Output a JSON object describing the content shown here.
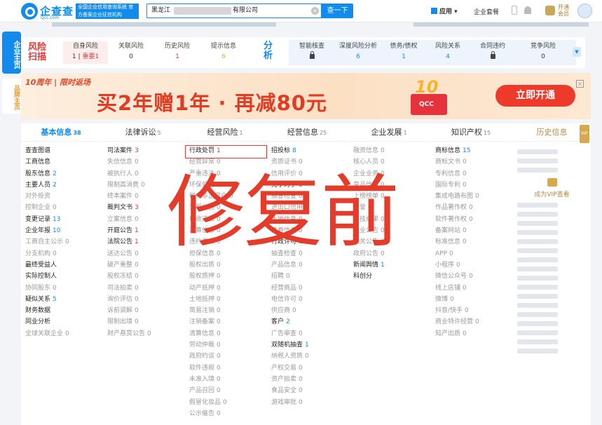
{
  "header": {
    "logo_name": "企查查",
    "logo_sub": "Qcc.com",
    "slogan": "全国企业信用查询系统 官方备案企业征信机构",
    "search_prefix": "黑龙江",
    "search_suffix": "有限公司",
    "search_button": "查一下",
    "apps_label": "应用",
    "enterprise_pack": "企业套餐",
    "vip_label": "开通会员"
  },
  "side_tabs": {
    "main": "企业主页",
    "brand": "品牌主页"
  },
  "risk_scan": {
    "title": "风险扫描",
    "items": [
      {
        "label": "自身风险",
        "value": "1",
        "extra": "重要1"
      },
      {
        "label": "关联风险",
        "value": "0"
      },
      {
        "label": "历史风险",
        "value": "1"
      },
      {
        "label": "提示信息",
        "value": "6"
      }
    ]
  },
  "analysis": {
    "title": "分析",
    "items": [
      {
        "label": "智能核查",
        "value": ""
      },
      {
        "label": "深度风险分析",
        "value": "6"
      },
      {
        "label": "债务/债权",
        "value": "1"
      },
      {
        "label": "风险关系",
        "value": "4"
      },
      {
        "label": "合同违约",
        "value": ""
      },
      {
        "label": "竞争风险",
        "value": "0"
      }
    ]
  },
  "banner": {
    "tag": "10周年 | 限时返场",
    "headline": "买2年赠1年 · 再减80元",
    "gift_number": "10",
    "gift_text": "QCC",
    "cta": "立即开通"
  },
  "categories": [
    {
      "title": "基本信息",
      "count": "38",
      "items": [
        {
          "l": "查查图谱",
          "n": ""
        },
        {
          "l": "工商信息",
          "n": ""
        },
        {
          "l": "股东信息",
          "n": "2"
        },
        {
          "l": "主要人员",
          "n": "2"
        },
        {
          "l": "对外投资",
          "n": "",
          "g": true
        },
        {
          "l": "控制企业",
          "n": "0",
          "g": true
        },
        {
          "l": "变更记录",
          "n": "13"
        },
        {
          "l": "企业年报",
          "n": "10"
        },
        {
          "l": "工商自主公示",
          "n": "0",
          "g": true
        },
        {
          "l": "分支机构",
          "n": "0",
          "g": true
        },
        {
          "l": "最终受益人",
          "n": ""
        },
        {
          "l": "实际控制人",
          "n": ""
        },
        {
          "l": "协同股东",
          "n": "0",
          "g": true
        },
        {
          "l": "疑似关系",
          "n": "5"
        },
        {
          "l": "财务数据",
          "n": ""
        },
        {
          "l": "同业分析",
          "n": ""
        },
        {
          "l": "全球关联企业",
          "n": "0",
          "g": true
        }
      ]
    },
    {
      "title": "法律诉讼",
      "count": "5",
      "items": [
        {
          "l": "司法案件",
          "n": "3",
          "r": true
        },
        {
          "l": "失信信息",
          "n": "0",
          "g": true
        },
        {
          "l": "被执行人",
          "n": "0",
          "g": true
        },
        {
          "l": "限制高消费",
          "n": "0",
          "g": true
        },
        {
          "l": "终本案件",
          "n": "0",
          "g": true
        },
        {
          "l": "裁判文书",
          "n": "3",
          "r": true
        },
        {
          "l": "立案信息",
          "n": "0",
          "g": true
        },
        {
          "l": "开庭公告",
          "n": "1",
          "r": true
        },
        {
          "l": "法院公告",
          "n": "1",
          "r": true
        },
        {
          "l": "送达公告",
          "n": "0",
          "g": true
        },
        {
          "l": "破产重整",
          "n": "0",
          "g": true
        },
        {
          "l": "股权冻结",
          "n": "0",
          "g": true
        },
        {
          "l": "司法拍卖",
          "n": "0",
          "g": true
        },
        {
          "l": "询价评估",
          "n": "0",
          "g": true
        },
        {
          "l": "诉前调解",
          "n": "0",
          "g": true
        },
        {
          "l": "限制出境",
          "n": "0",
          "g": true
        },
        {
          "l": "财产悬赏公告",
          "n": "0",
          "g": true
        }
      ]
    },
    {
      "title": "经营风险",
      "count": "1",
      "items": [
        {
          "l": "行政处罚",
          "n": "1",
          "r": true
        },
        {
          "l": "经营异常",
          "n": "0",
          "g": true
        },
        {
          "l": "严重违法",
          "n": "0",
          "g": true
        },
        {
          "l": "环保处罚",
          "n": "0",
          "g": true
        },
        {
          "l": "税务非正常户",
          "n": "0",
          "g": true
        },
        {
          "l": "欠税公告",
          "n": "0",
          "g": true
        },
        {
          "l": "税收违法",
          "n": "0",
          "g": true
        },
        {
          "l": "清算信息",
          "n": "0",
          "g": true
        },
        {
          "l": "违约事项",
          "n": "0",
          "g": true
        },
        {
          "l": "担保信息",
          "n": "0",
          "g": true
        },
        {
          "l": "股权出质",
          "n": "0",
          "g": true
        },
        {
          "l": "股权质押",
          "n": "0",
          "g": true
        },
        {
          "l": "动产抵押",
          "n": "0",
          "g": true
        },
        {
          "l": "土地抵押",
          "n": "0",
          "g": true
        },
        {
          "l": "简易注销",
          "n": "0",
          "g": true
        },
        {
          "l": "注销备案",
          "n": "0",
          "g": true
        },
        {
          "l": "清算信息",
          "n": "0",
          "g": true
        },
        {
          "l": "劳动仲裁",
          "n": "0",
          "g": true
        },
        {
          "l": "政府约谈",
          "n": "0",
          "g": true
        },
        {
          "l": "软件违规",
          "n": "0",
          "g": true
        },
        {
          "l": "未准入境",
          "n": "0",
          "g": true
        },
        {
          "l": "产品召回",
          "n": "0",
          "g": true
        },
        {
          "l": "假冒化妆品",
          "n": "0",
          "g": true
        },
        {
          "l": "公示催告",
          "n": "0",
          "g": true
        }
      ]
    },
    {
      "title": "经营信息",
      "count": "25",
      "items": [
        {
          "l": "招投标",
          "n": "8"
        },
        {
          "l": "资质证书",
          "n": "0",
          "g": true
        },
        {
          "l": "信用评价",
          "n": "0",
          "g": true
        },
        {
          "l": "竞争对手",
          "n": "1"
        },
        {
          "l": "抽查检查",
          "n": "0",
          "g": true
        },
        {
          "l": "进出口信用",
          "n": "0",
          "g": true
        },
        {
          "l": "土地信息",
          "n": "0",
          "g": true
        },
        {
          "l": "债券信息",
          "n": "0",
          "g": true
        },
        {
          "l": "行政许可",
          "n": "13"
        },
        {
          "l": "抽查检查",
          "n": "0",
          "g": true
        },
        {
          "l": "产品信息",
          "n": "0",
          "g": true
        },
        {
          "l": "招聘",
          "n": "0",
          "g": true
        },
        {
          "l": "经营商品",
          "n": "0",
          "g": true
        },
        {
          "l": "电信许可",
          "n": "0",
          "g": true
        },
        {
          "l": "供应商",
          "n": "0",
          "g": true
        },
        {
          "l": "客户",
          "n": "2"
        },
        {
          "l": "广告审查",
          "n": "0",
          "g": true
        },
        {
          "l": "双随机抽查",
          "n": "1"
        },
        {
          "l": "纳税人资质",
          "n": "0",
          "g": true
        },
        {
          "l": "产权交易",
          "n": "0",
          "g": true
        },
        {
          "l": "资产拍卖",
          "n": "0",
          "g": true
        },
        {
          "l": "食品安全",
          "n": "0",
          "g": true
        },
        {
          "l": "游戏审批",
          "n": "0",
          "g": true
        }
      ]
    },
    {
      "title": "企业发展",
      "count": "1",
      "items": [
        {
          "l": "融资信息",
          "n": "0",
          "g": true
        },
        {
          "l": "核心人员",
          "n": "0",
          "g": true
        },
        {
          "l": "企业业务",
          "n": "0",
          "g": true
        },
        {
          "l": "竞品信息",
          "n": "0",
          "g": true
        },
        {
          "l": "上榜榜单",
          "n": "0",
          "g": true
        },
        {
          "l": "荣誉",
          "n": "0",
          "g": true
        },
        {
          "l": "科技成果",
          "n": "0",
          "g": true
        },
        {
          "l": "企业公告",
          "n": "0",
          "g": true
        },
        {
          "l": "相关公告",
          "n": "0",
          "g": true
        },
        {
          "l": "政府公告",
          "n": "0",
          "g": true
        },
        {
          "l": "新闻舆情",
          "n": "1"
        },
        {
          "l": "科创分",
          "n": ""
        }
      ]
    },
    {
      "title": "知识产权",
      "count": "15",
      "items": [
        {
          "l": "商标信息",
          "n": "15"
        },
        {
          "l": "商标文书",
          "n": "0",
          "g": true
        },
        {
          "l": "专利信息",
          "n": "0",
          "g": true
        },
        {
          "l": "国际专利",
          "n": "0",
          "g": true
        },
        {
          "l": "集成电路布图",
          "n": "0",
          "g": true
        },
        {
          "l": "作品著作权",
          "n": "0",
          "g": true
        },
        {
          "l": "软件著作权",
          "n": "0",
          "g": true
        },
        {
          "l": "备案网站",
          "n": "0",
          "g": true
        },
        {
          "l": "标准信息",
          "n": "0",
          "g": true
        },
        {
          "l": "APP",
          "n": "0",
          "g": true
        },
        {
          "l": "小程序",
          "n": "0",
          "g": true
        },
        {
          "l": "微信公众号",
          "n": "0",
          "g": true
        },
        {
          "l": "线上店铺",
          "n": "0",
          "g": true
        },
        {
          "l": "微博",
          "n": "0",
          "g": true
        },
        {
          "l": "抖音/快手",
          "n": "0",
          "g": true
        },
        {
          "l": "商业特许经营",
          "n": "0",
          "g": true
        },
        {
          "l": "知产出质",
          "n": "0",
          "g": true
        }
      ]
    }
  ],
  "history": {
    "title": "历史信息",
    "vip_badge": "VIP",
    "vip_view": "成为VIP查看"
  },
  "watermark": "修复前"
}
